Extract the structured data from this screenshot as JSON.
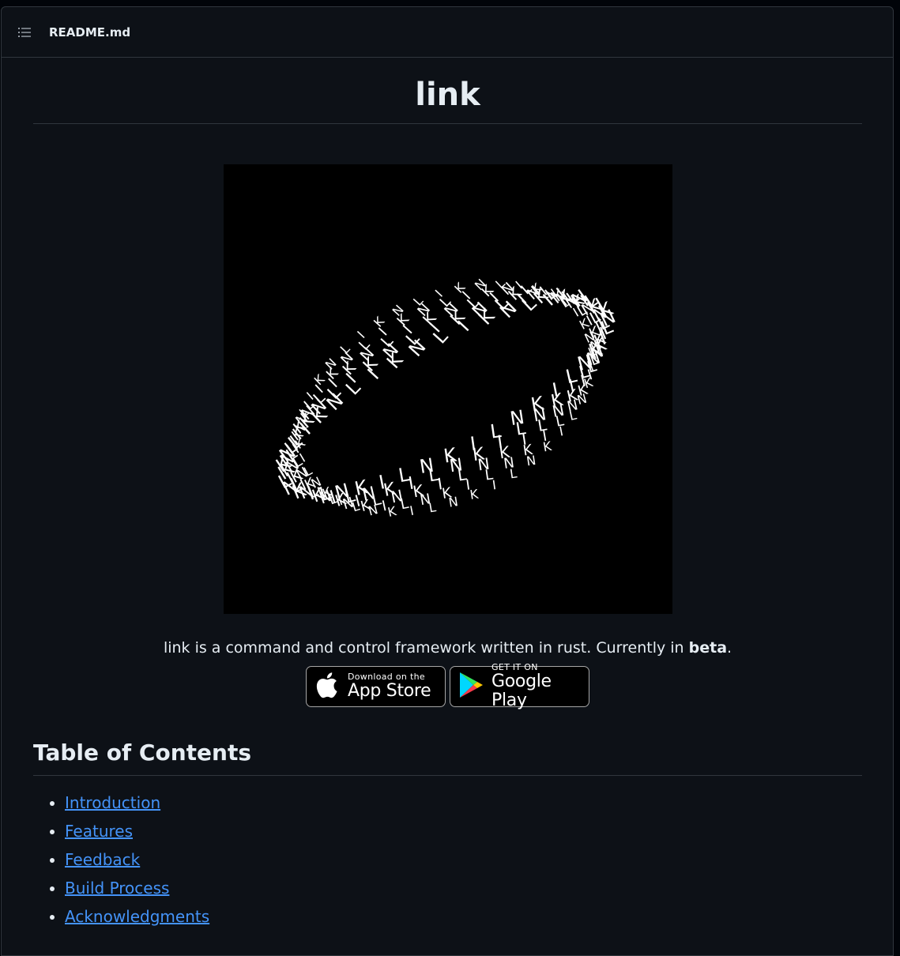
{
  "header": {
    "filename": "README.md",
    "toc_icon": "list-unordered-icon"
  },
  "readme": {
    "title": "link",
    "tagline_prefix": "link is a command and control framework written in rust. Currently in ",
    "tagline_bold": "beta",
    "tagline_suffix": ".",
    "badges": {
      "app_store": {
        "small": "Download on the",
        "big": "App Store",
        "icon": "apple-icon"
      },
      "google_play": {
        "small": "GET IT ON",
        "big": "Google Play",
        "icon": "google-play-icon"
      }
    },
    "hero_letters": [
      "K",
      "N",
      "L",
      "I"
    ],
    "toc_heading": "Table of Contents",
    "toc_items": [
      {
        "label": "Introduction"
      },
      {
        "label": "Features"
      },
      {
        "label": "Feedback"
      },
      {
        "label": "Build Process"
      },
      {
        "label": "Acknowledgments"
      }
    ]
  }
}
